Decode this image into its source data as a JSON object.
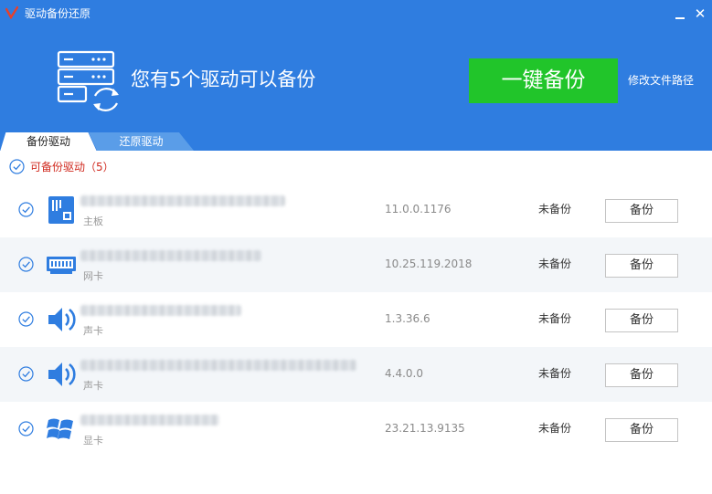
{
  "window": {
    "title": "驱动备份还原"
  },
  "header": {
    "headline": "您有5个驱动可以备份",
    "backup_all_label": "一键备份",
    "change_path_label": "修改文件路径"
  },
  "tabs": [
    {
      "label": "备份驱动",
      "active": true
    },
    {
      "label": "还原驱动",
      "active": false
    }
  ],
  "section": {
    "title": "可备份驱动（5）"
  },
  "drivers": [
    {
      "type": "主板",
      "version": "11.0.0.1176",
      "status": "未备份",
      "action": "备份",
      "icon": "motherboard-icon"
    },
    {
      "type": "网卡",
      "version": "10.25.119.2018",
      "status": "未备份",
      "action": "备份",
      "icon": "network-card-icon"
    },
    {
      "type": "声卡",
      "version": "1.3.36.6",
      "status": "未备份",
      "action": "备份",
      "icon": "speaker-icon"
    },
    {
      "type": "声卡",
      "version": "4.4.0.0",
      "status": "未备份",
      "action": "备份",
      "icon": "speaker-icon"
    },
    {
      "type": "显卡",
      "version": "23.21.13.9135",
      "status": "未备份",
      "action": "备份",
      "icon": "windows-icon"
    }
  ],
  "colors": {
    "header_blue": "#2f7de0",
    "button_green": "#21c52a",
    "section_red": "#d02a1f",
    "icon_blue": "#2f7de0"
  }
}
